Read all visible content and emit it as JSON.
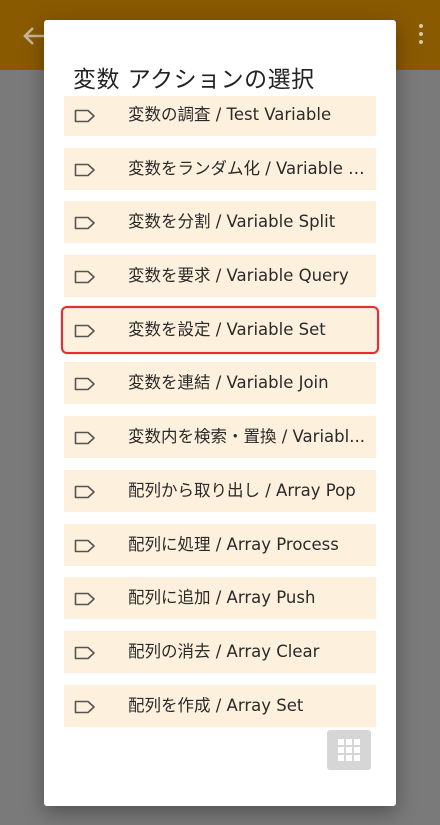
{
  "dialog": {
    "title": "変数 アクションの選択"
  },
  "items": [
    {
      "label": "変数の調査 / Test Variable"
    },
    {
      "label": "変数をランダム化 / Variable R..."
    },
    {
      "label": "変数を分割 / Variable Split"
    },
    {
      "label": "変数を要求 / Variable Query"
    },
    {
      "label": "変数を設定 / Variable Set",
      "selected": true
    },
    {
      "label": "変数を連結 / Variable Join"
    },
    {
      "label": "変数内を検索・置換 / Variabl..."
    },
    {
      "label": "配列から取り出し / Array Pop"
    },
    {
      "label": "配列に処理 / Array Process"
    },
    {
      "label": "配列に追加 / Array Push"
    },
    {
      "label": "配列の消去 / Array Clear"
    },
    {
      "label": "配列を作成 / Array Set"
    }
  ],
  "icons": {
    "item_icon": "label-tag-icon",
    "grid_button_icon": "grid-icon",
    "back": "back-arrow-icon",
    "overflow": "more-vert-icon"
  },
  "colors": {
    "appbar": "#8a5a00",
    "item_background": "#fdf0dc",
    "selection_outline": "#e03030",
    "grid_button": "#d6d6d6"
  }
}
